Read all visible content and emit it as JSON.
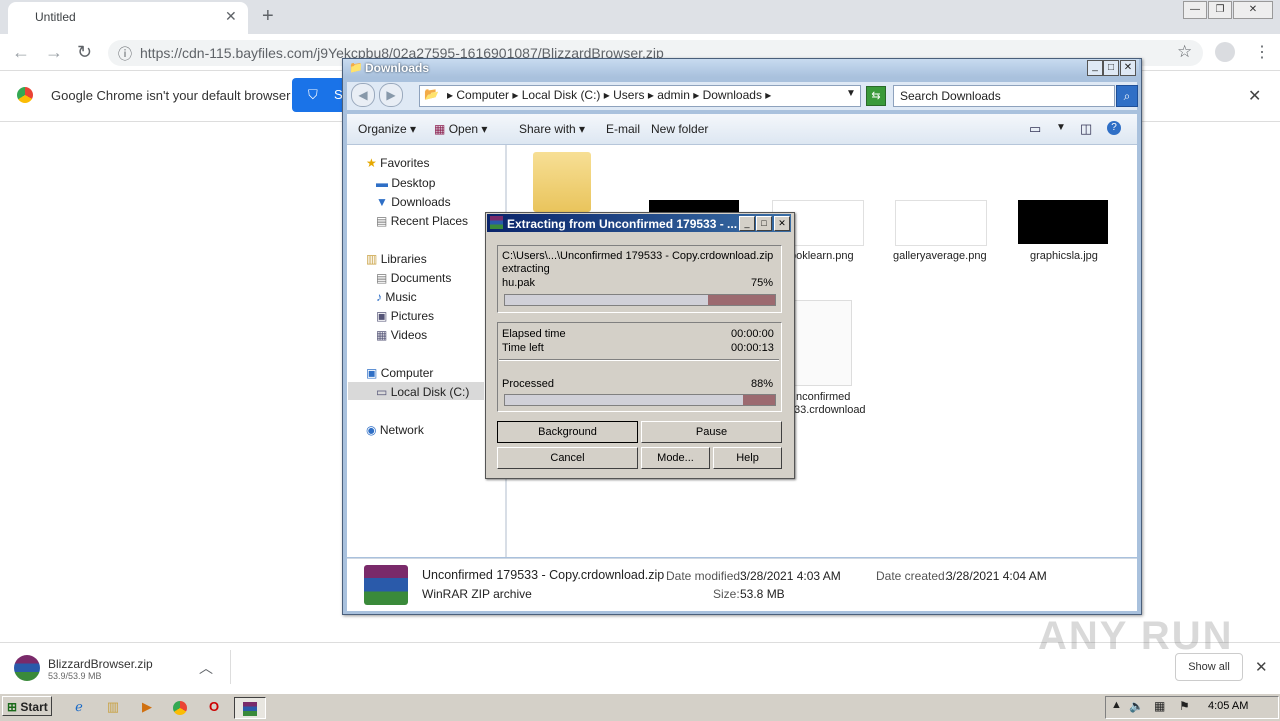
{
  "browser": {
    "tab_title": "Untitled",
    "url": "https://cdn-115.bayfiles.com/j9Yekcpbu8/02a27595-1616901087/BlizzardBrowser.zip",
    "infobar_text": "Google Chrome isn't your default browser",
    "infobar_button_partial": "S"
  },
  "explorer": {
    "title": "Downloads",
    "breadcrumb": [
      "Computer",
      "Local Disk (C:)",
      "Users",
      "admin",
      "Downloads"
    ],
    "search_placeholder": "Search Downloads",
    "commands": {
      "organize": "Organize",
      "open": "Open",
      "share_with": "Share with",
      "email": "E-mail",
      "new_folder": "New folder"
    },
    "nav": {
      "favorites": "Favorites",
      "desktop": "Desktop",
      "downloads": "Downloads",
      "recent_places": "Recent Places",
      "libraries": "Libraries",
      "documents": "Documents",
      "music": "Music",
      "pictures": "Pictures",
      "videos": "Videos",
      "computer": "Computer",
      "local_disk": "Local Disk (C:)",
      "network": "Network"
    },
    "files": {
      "f1": "ooklearn.png",
      "f2": "galleryaverage.png",
      "f3": "graphicsla.jpg",
      "f4_line1": "nconfirmed",
      "f4_line2": "33.crdownload"
    },
    "details": {
      "name": "Unconfirmed 179533 - Copy.crdownload.zip",
      "type": "WinRAR ZIP archive",
      "date_modified_label": "Date modified:",
      "date_modified": "3/28/2021 4:03 AM",
      "date_created_label": "Date created:",
      "date_created": "3/28/2021 4:04 AM",
      "size_label": "Size:",
      "size": "53.8 MB"
    }
  },
  "rar": {
    "title": "Extracting from Unconfirmed 179533 - ...",
    "archive_path": "C:\\Users\\...\\Unconfirmed 179533 - Copy.crdownload.zip",
    "action": "extracting",
    "current_file": "hu.pak",
    "file_percent_text": "75%",
    "file_progress": 0.75,
    "elapsed_label": "Elapsed time",
    "elapsed": "00:00:00",
    "timeleft_label": "Time left",
    "timeleft": "00:00:13",
    "processed_label": "Processed",
    "processed_percent_text": "88%",
    "processed_progress": 0.88,
    "buttons": {
      "background": "Background",
      "pause": "Pause",
      "cancel": "Cancel",
      "mode": "Mode...",
      "help": "Help"
    }
  },
  "download_shelf": {
    "file_name": "BlizzardBrowser.zip",
    "file_size": "53.9/53.9 MB",
    "show_all": "Show all"
  },
  "taskbar": {
    "start": "Start",
    "clock": "4:05 AM"
  },
  "watermark": "ANY RUN"
}
